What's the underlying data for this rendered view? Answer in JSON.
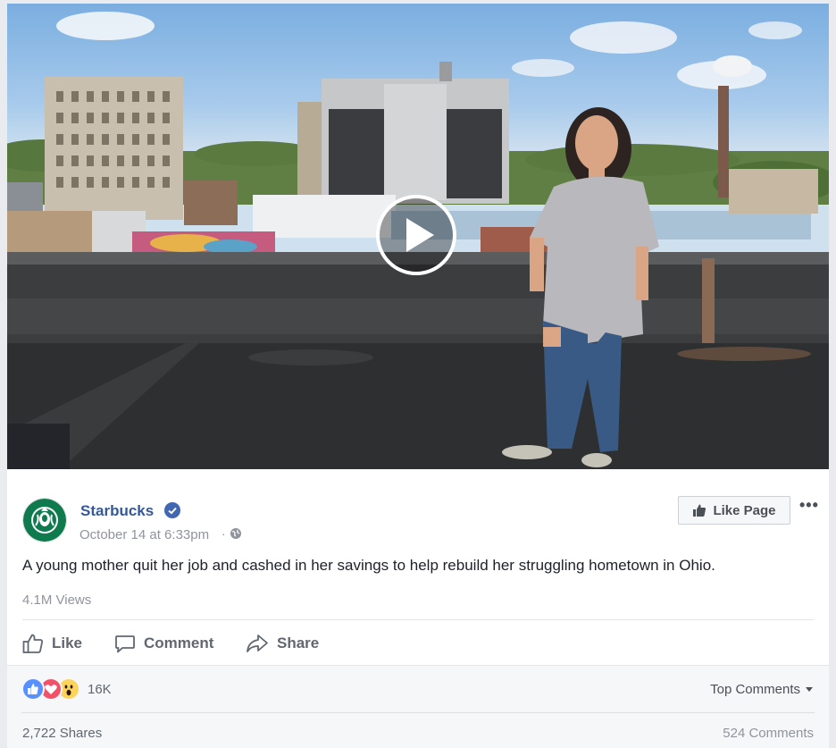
{
  "video": {
    "play_icon": "play-icon"
  },
  "post": {
    "page_name": "Starbucks",
    "verified_icon": "verified-badge-icon",
    "date": "October 14 at 6:33pm",
    "separator": "·",
    "privacy_icon": "globe-icon",
    "like_page_label": "Like Page",
    "more_icon": "more-options-icon",
    "text": "A young mother quit her job and cashed in her savings to help rebuild her struggling hometown in Ohio.",
    "views": "4.1M Views"
  },
  "actions": {
    "like_label": "Like",
    "comment_label": "Comment",
    "share_label": "Share"
  },
  "reactions": {
    "icons": [
      "like-reaction-icon",
      "love-reaction-icon",
      "wow-reaction-icon"
    ],
    "count": "16K",
    "top_comments_label": "Top Comments"
  },
  "footer": {
    "shares": "2,722 Shares",
    "comments": "524 Comments"
  },
  "colors": {
    "link_blue": "#365899",
    "like_blue": "#5890ff",
    "love_red": "#f25268",
    "wow_yellow": "#fcd45b",
    "background": "#e9ebee"
  }
}
